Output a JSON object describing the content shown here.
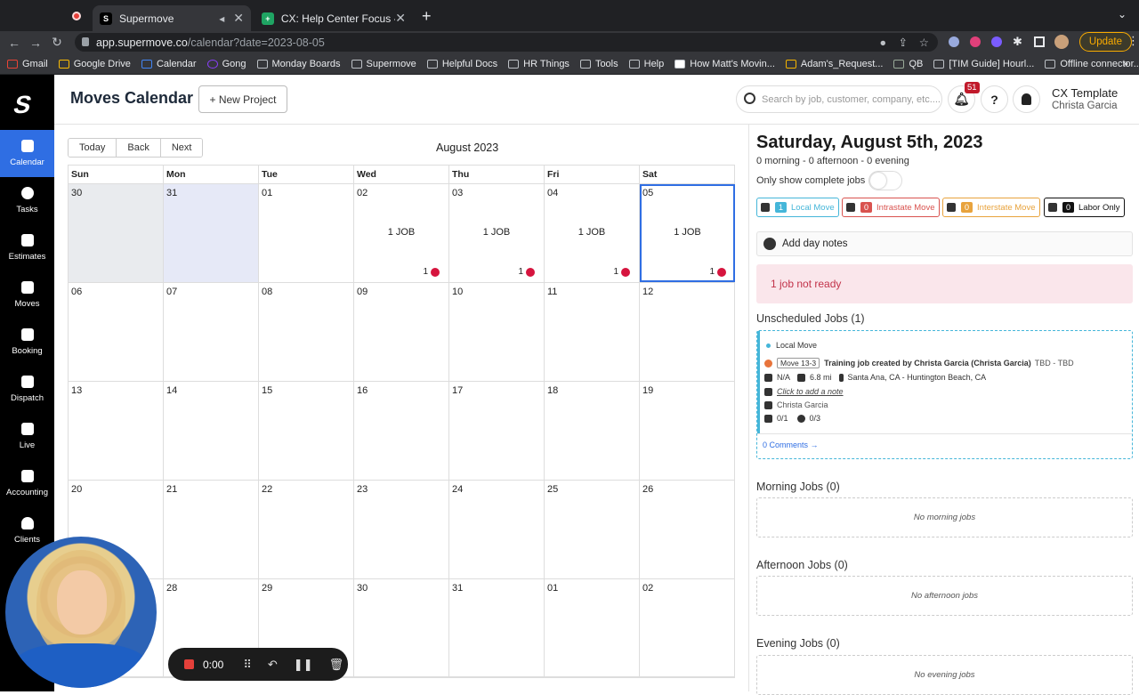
{
  "browser": {
    "tabs": [
      {
        "title": "Supermove"
      },
      {
        "title": "CX: Help Center Focus - Googl"
      }
    ],
    "url_host": "app.supermove.co",
    "url_path": "/calendar?date=2023-08-05",
    "update_label": "Update",
    "bookmarks": [
      "Gmail",
      "Google Drive",
      "Calendar",
      "Gong",
      "Monday Boards",
      "Supermove",
      "Helpful Docs",
      "HR Things",
      "Tools",
      "Help",
      "How Matt's Movin...",
      "Adam's_Request...",
      "QB",
      "[TIM Guide] Hourl...",
      "Offline connector..."
    ]
  },
  "sidebar": {
    "items": [
      {
        "label": "Calendar"
      },
      {
        "label": "Tasks"
      },
      {
        "label": "Estimates"
      },
      {
        "label": "Moves"
      },
      {
        "label": "Booking"
      },
      {
        "label": "Dispatch"
      },
      {
        "label": "Live"
      },
      {
        "label": "Accounting"
      },
      {
        "label": "Clients"
      }
    ]
  },
  "header": {
    "title": "Moves Calendar",
    "new_project": "+ New Project",
    "search_placeholder": "Search by job, customer, company, etc....",
    "notification_count": "51",
    "org": "CX Template",
    "user": "Christa Garcia"
  },
  "calendar": {
    "nav": [
      "Today",
      "Back",
      "Next"
    ],
    "month": "August 2023",
    "dow": [
      "Sun",
      "Mon",
      "Tue",
      "Wed",
      "Thu",
      "Fri",
      "Sat"
    ],
    "weeks": [
      [
        {
          "d": "30"
        },
        {
          "d": "31"
        },
        {
          "d": "01"
        },
        {
          "d": "02",
          "jobs": "1 JOB",
          "count": "1"
        },
        {
          "d": "03",
          "jobs": "1 JOB",
          "count": "1"
        },
        {
          "d": "04",
          "jobs": "1 JOB",
          "count": "1"
        },
        {
          "d": "05",
          "jobs": "1 JOB",
          "count": "1"
        }
      ],
      [
        {
          "d": "06"
        },
        {
          "d": "07"
        },
        {
          "d": "08"
        },
        {
          "d": "09"
        },
        {
          "d": "10"
        },
        {
          "d": "11"
        },
        {
          "d": "12"
        }
      ],
      [
        {
          "d": "13"
        },
        {
          "d": "14"
        },
        {
          "d": "15"
        },
        {
          "d": "16"
        },
        {
          "d": "17"
        },
        {
          "d": "18"
        },
        {
          "d": "19"
        }
      ],
      [
        {
          "d": "20"
        },
        {
          "d": "21"
        },
        {
          "d": "22"
        },
        {
          "d": "23"
        },
        {
          "d": "24"
        },
        {
          "d": "25"
        },
        {
          "d": "26"
        }
      ],
      [
        {
          "d": ""
        },
        {
          "d": "28"
        },
        {
          "d": "29"
        },
        {
          "d": "30"
        },
        {
          "d": "31"
        },
        {
          "d": "01"
        },
        {
          "d": "02"
        }
      ]
    ]
  },
  "day_panel": {
    "title": "Saturday, August 5th, 2023",
    "subtitle": "0 morning - 0 afternoon - 0 evening",
    "toggle_label": "Only show complete jobs",
    "filters": [
      {
        "num": "1",
        "label": "Local Move",
        "color": "#45b6d9"
      },
      {
        "num": "0",
        "label": "Intrastate Move",
        "color": "#d9534f"
      },
      {
        "num": "0",
        "label": "Interstate Move",
        "color": "#e8a33d"
      },
      {
        "num": "0",
        "label": "Labor Only",
        "color": "#111111"
      }
    ],
    "day_notes": "Add day notes",
    "not_ready": "1 job not ready",
    "unscheduled_title": "Unscheduled Jobs (1)",
    "job": {
      "type": "Local Move",
      "move_tag": "Move 13-3",
      "title": "Training job created by Christa Garcia (Christa Garcia)",
      "tbd": "TBD - TBD",
      "size": "N/A",
      "distance": "6.8 mi",
      "route": "Santa Ana, CA - Huntington Beach, CA",
      "note": "Click to add a note",
      "owner": "Christa Garcia",
      "trucks": "0/1",
      "crew": "0/3",
      "comments": "0 Comments →"
    },
    "morning_title": "Morning Jobs (0)",
    "morning_empty": "No morning jobs",
    "afternoon_title": "Afternoon Jobs (0)",
    "afternoon_empty": "No afternoon jobs",
    "evening_title": "Evening Jobs (0)",
    "evening_empty": "No evening jobs"
  },
  "recorder": {
    "time": "0:00"
  }
}
